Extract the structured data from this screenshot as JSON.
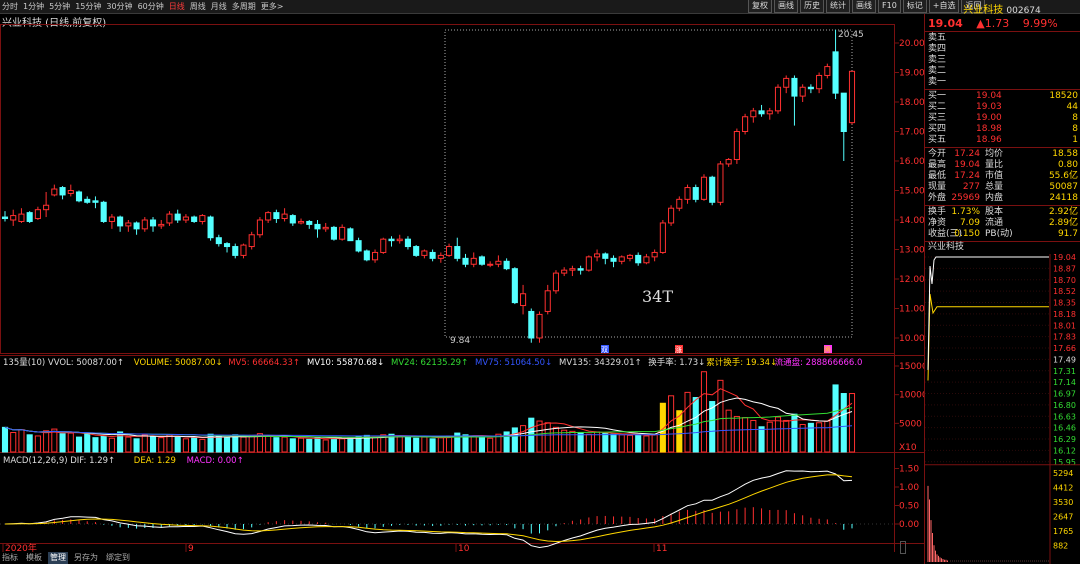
{
  "periods": [
    "分时",
    "1分钟",
    "5分钟",
    "15分钟",
    "30分钟",
    "60分钟",
    "日线",
    "周线",
    "月线",
    "多周期",
    "更多>"
  ],
  "active_period": "日线",
  "toolbar": [
    "复权",
    "画线",
    "历史",
    "统计",
    "画线",
    "F10",
    "标记",
    "+自选",
    "返回"
  ],
  "title": "兴业科技 (日线,前复权)",
  "annotations": {
    "high": "20.45",
    "low": "9.84",
    "box_label": "34T"
  },
  "price_axis": [
    "20.00",
    "19.00",
    "18.00",
    "17.00",
    "16.00",
    "15.00",
    "14.00",
    "13.00",
    "12.00",
    "11.00",
    "10.00"
  ],
  "signal_tags": [
    "双",
    "涨",
    "腾"
  ],
  "volume_header": [
    {
      "t": "135量(10) VVOL: 50087.00↑",
      "c": "#dddddd"
    },
    {
      "t": "VOLUME: 50087.00↓",
      "c": "#ffd700"
    },
    {
      "t": "MV5: 66664.33↑",
      "c": "#ff3030"
    },
    {
      "t": "MV10: 55870.68↓",
      "c": "#ffffff"
    },
    {
      "t": "MV24: 62135.29↑",
      "c": "#33dd33"
    },
    {
      "t": "MV75: 51064.50↓",
      "c": "#3355ff"
    },
    {
      "t": "MV135: 34329.01↑",
      "c": "#dddddd"
    },
    {
      "t": "换手率: 1.73↓",
      "c": "#dddddd"
    },
    {
      "t": "累计换手: 19.34↓",
      "c": "#ffd700"
    },
    {
      "t": "流通盘: 288866666.0",
      "c": "#ff33ff"
    }
  ],
  "volume_axis": [
    "15000",
    "10000",
    "5000",
    "X10"
  ],
  "macd_header": [
    {
      "t": "MACD(12,26,9) DIF: 1.29↑",
      "c": "#dddddd"
    },
    {
      "t": "DEA: 1.29",
      "c": "#ffd700"
    },
    {
      "t": "MACD: 0.00↑",
      "c": "#ff33ff"
    }
  ],
  "macd_axis": [
    "1.50",
    "1.00",
    "0.50",
    "0.00"
  ],
  "date_axis": [
    "2020年",
    "9",
    "10",
    "11"
  ],
  "bottom_tabs": [
    "指标",
    "模板",
    "管理",
    "另存为",
    "绑定到"
  ],
  "bottom_selected": "管理",
  "right_panel": {
    "name": "兴业科技",
    "code": "002674",
    "price": "19.04",
    "change": "▲1.73",
    "pct": "9.99%",
    "asks": [
      {
        "l": "卖五",
        "p": "",
        "v": ""
      },
      {
        "l": "卖四",
        "p": "",
        "v": ""
      },
      {
        "l": "卖三",
        "p": "",
        "v": ""
      },
      {
        "l": "卖二",
        "p": "",
        "v": ""
      },
      {
        "l": "卖一",
        "p": "",
        "v": ""
      }
    ],
    "bids": [
      {
        "l": "买一",
        "p": "19.04",
        "v": "18520"
      },
      {
        "l": "买二",
        "p": "19.03",
        "v": "44"
      },
      {
        "l": "买三",
        "p": "19.00",
        "v": "8"
      },
      {
        "l": "买四",
        "p": "18.98",
        "v": "8"
      },
      {
        "l": "买五",
        "p": "18.96",
        "v": "1"
      }
    ],
    "stats": [
      {
        "a": "今开",
        "b": "17.24",
        "c": "均价",
        "d": "18.58"
      },
      {
        "a": "最高",
        "b": "19.04",
        "c": "量比",
        "d": "0.80"
      },
      {
        "a": "最低",
        "b": "17.24",
        "c": "市值",
        "d": "55.6亿"
      },
      {
        "a": "现量",
        "b": "277",
        "c": "总量",
        "d": "50087"
      },
      {
        "a": "外盘",
        "b": "25969",
        "c": "内盘",
        "d": "24118"
      }
    ],
    "stats2": [
      {
        "a": "换手",
        "b": "1.73%",
        "c": "股本",
        "d": "2.92亿"
      },
      {
        "a": "净资",
        "b": "7.09",
        "c": "流通",
        "d": "2.89亿"
      },
      {
        "a": "收益(三)",
        "b": "0.150",
        "c": "PB(动)",
        "d": "91.7"
      }
    ],
    "mini_title": "兴业科技",
    "mini_axis": [
      "19.04",
      "18.87",
      "18.70",
      "18.52",
      "18.35",
      "18.18",
      "18.01",
      "17.83",
      "17.66",
      "17.49",
      "17.31",
      "17.14",
      "16.97",
      "16.80",
      "16.63",
      "16.46",
      "16.29",
      "16.12",
      "15.95"
    ],
    "mini_vol_axis": [
      "5294",
      "4412",
      "3530",
      "2647",
      "1765",
      "882"
    ],
    "period_label": "日线"
  },
  "colors": {
    "up": "#ff3030",
    "down": "#54ffff",
    "frame": "#7a1010",
    "bg": "#000000"
  }
}
